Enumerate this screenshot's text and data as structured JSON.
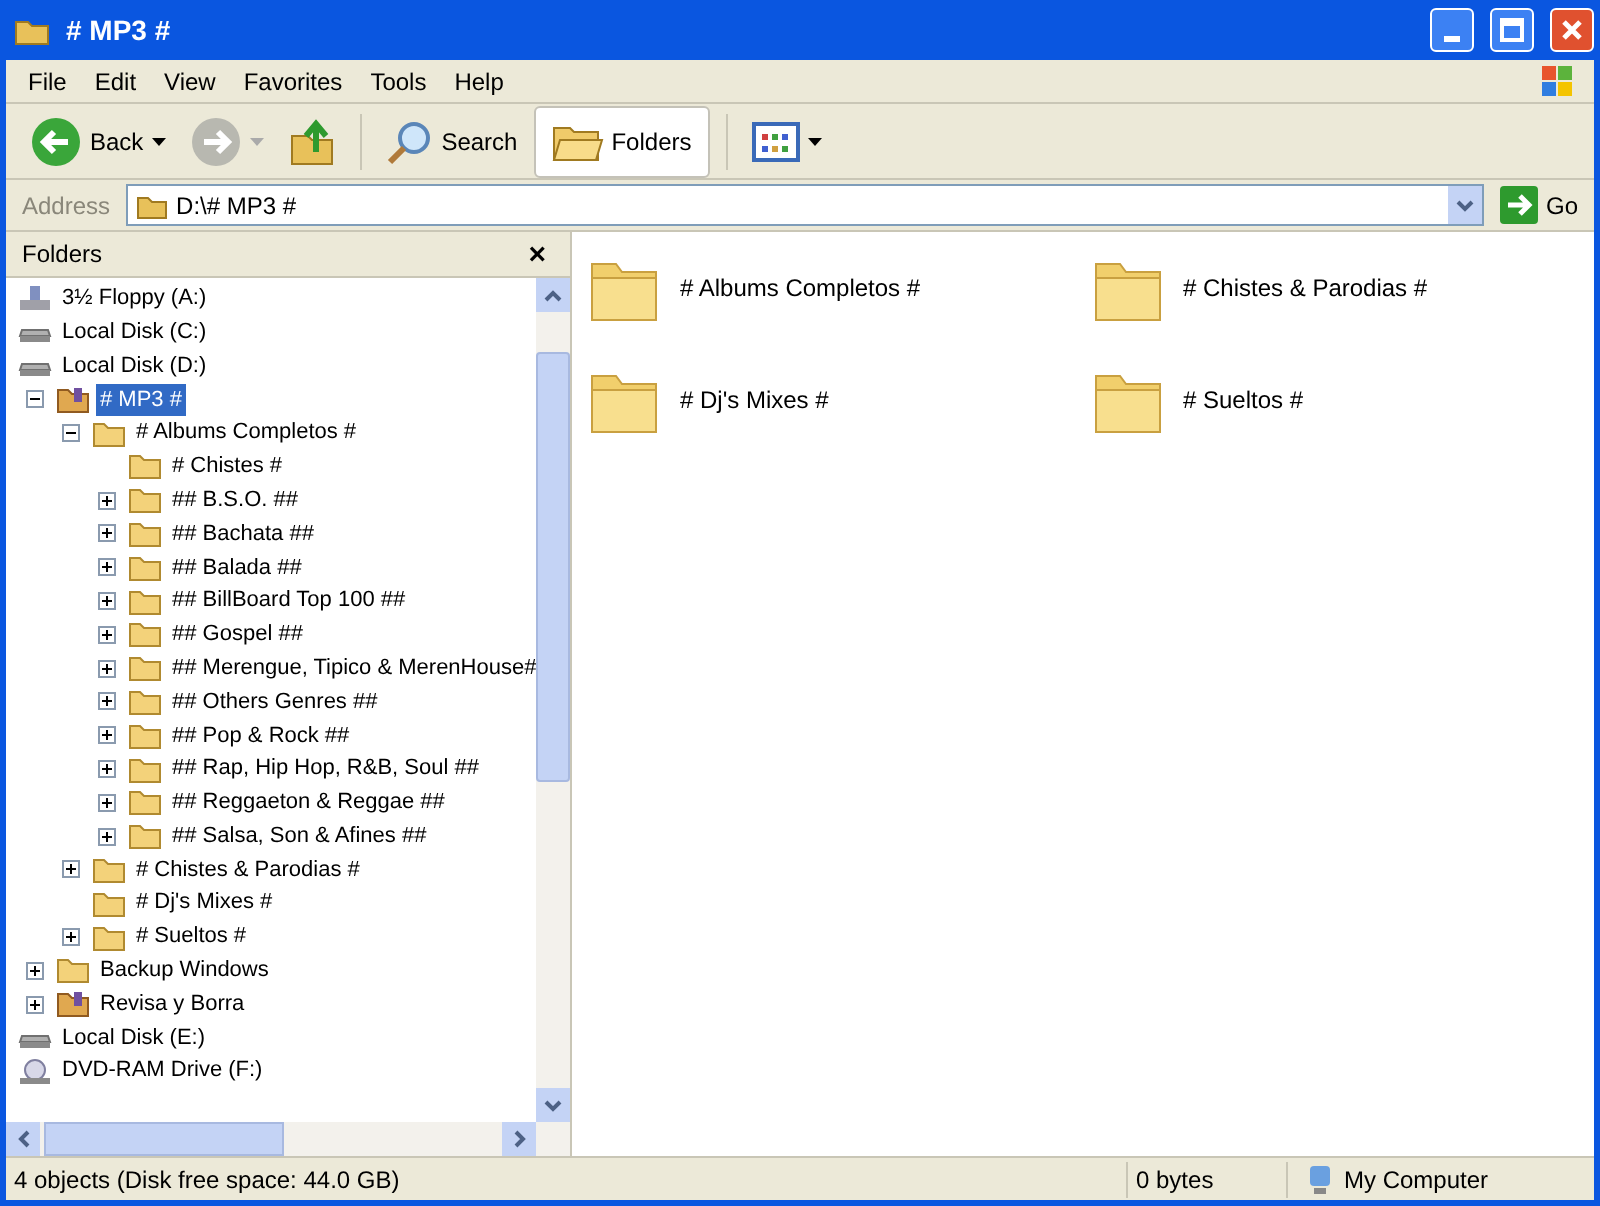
{
  "window": {
    "title": "# MP3 #"
  },
  "menu": [
    "File",
    "Edit",
    "View",
    "Favorites",
    "Tools",
    "Help"
  ],
  "toolbar": {
    "back": "Back",
    "search": "Search",
    "folders": "Folders"
  },
  "address": {
    "label": "Address",
    "value": "D:\\# MP3 #",
    "go": "Go"
  },
  "folders_pane": {
    "title": "Folders",
    "close": "×"
  },
  "tree": [
    {
      "label": "3½ Floppy (A:)",
      "kind": "floppy",
      "selected": false
    },
    {
      "label": "Local Disk (C:)",
      "kind": "disk",
      "selected": false
    },
    {
      "label": "Local Disk (D:)",
      "kind": "disk",
      "selected": false,
      "children": [
        {
          "label": "# MP3 #",
          "kind": "special",
          "expanded": true,
          "selected": true,
          "children": [
            {
              "label": "# Albums Completos #",
              "kind": "folder",
              "expanded": true,
              "selected": false,
              "children": [
                {
                  "label": "# Chistes #",
                  "kind": "folder",
                  "selected": false
                },
                {
                  "label": "## B.S.O. ##",
                  "kind": "folder",
                  "expanded": false,
                  "selected": false
                },
                {
                  "label": "## Bachata ##",
                  "kind": "folder",
                  "expanded": false,
                  "selected": false
                },
                {
                  "label": "## Balada ##",
                  "kind": "folder",
                  "expanded": false,
                  "selected": false
                },
                {
                  "label": "## BillBoard Top 100 ##",
                  "kind": "folder",
                  "expanded": false,
                  "selected": false
                },
                {
                  "label": "## Gospel ##",
                  "kind": "folder",
                  "expanded": false,
                  "selected": false
                },
                {
                  "label": "## Merengue, Tipico & MerenHouse#",
                  "kind": "folder",
                  "expanded": false,
                  "selected": false
                },
                {
                  "label": "## Others Genres ##",
                  "kind": "folder",
                  "expanded": false,
                  "selected": false
                },
                {
                  "label": "## Pop & Rock ##",
                  "kind": "folder",
                  "expanded": false,
                  "selected": false
                },
                {
                  "label": "## Rap, Hip Hop, R&B, Soul ##",
                  "kind": "folder",
                  "expanded": false,
                  "selected": false
                },
                {
                  "label": "## Reggaeton & Reggae ##",
                  "kind": "folder",
                  "expanded": false,
                  "selected": false
                },
                {
                  "label": "## Salsa, Son & Afines ##",
                  "kind": "folder",
                  "expanded": false,
                  "selected": false
                }
              ]
            },
            {
              "label": "# Chistes & Parodias #",
              "kind": "folder",
              "expanded": false,
              "selected": false
            },
            {
              "label": "# Dj's Mixes #",
              "kind": "folder",
              "selected": false
            },
            {
              "label": "# Sueltos #",
              "kind": "folder",
              "expanded": false,
              "selected": false
            }
          ]
        },
        {
          "label": "Backup Windows",
          "kind": "folder",
          "expanded": false,
          "selected": false
        },
        {
          "label": "Revisa y Borra",
          "kind": "special",
          "expanded": false,
          "selected": false
        }
      ]
    },
    {
      "label": "Local Disk (E:)",
      "kind": "disk",
      "selected": false
    },
    {
      "label": "DVD-RAM Drive (F:)",
      "kind": "dvd",
      "selected": false
    }
  ],
  "items": [
    "# Albums Completos #",
    "# Chistes & Parodias #",
    "# Dj's Mixes #",
    "# Sueltos #"
  ],
  "status_bar": {
    "objects": "4 objects (Disk free space: 44.0 GB)",
    "size": "0 bytes",
    "zone": "My Computer"
  }
}
